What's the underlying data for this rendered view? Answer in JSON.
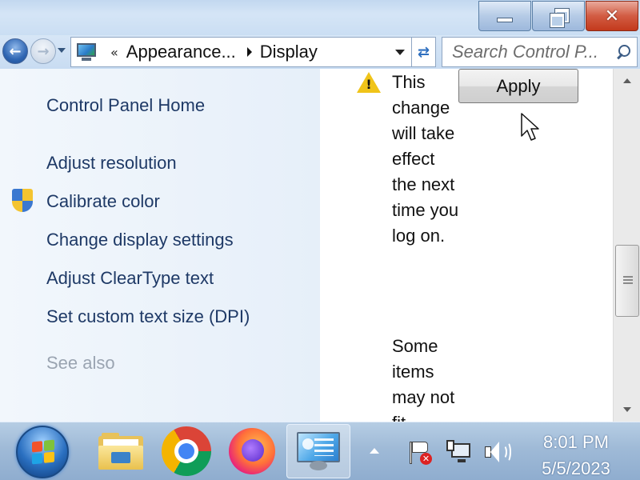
{
  "window": {
    "min_glyph": "—",
    "close_glyph": "✕"
  },
  "navigation": {
    "back_glyph": "←",
    "forward_glyph": "→",
    "breadcrumb_prefix": "«",
    "breadcrumbs": [
      "Appearance...",
      "Display"
    ],
    "refresh_glyph": "⇄",
    "search_placeholder": "Search Control P..."
  },
  "sidebar": {
    "home": "Control Panel Home",
    "links": [
      "Adjust resolution",
      "Calibrate color",
      "Change display settings",
      "Adjust ClearType text",
      "Set custom text size (DPI)"
    ],
    "see_also": "See also"
  },
  "content": {
    "warning_text": "This change will take effect the next time you log on.",
    "second_text": "Some items may not fit",
    "apply_label": "Apply"
  },
  "taskbar": {
    "apps": [
      "windows-explorer",
      "google-chrome",
      "firefox",
      "display-control-panel"
    ],
    "active_app": "display-control-panel",
    "time": "8:01 PM",
    "date": "5/5/2023"
  },
  "colors": {
    "link": "#1e3966",
    "see_also": "#9aa4b1",
    "close_button": "#c3391c",
    "warning": "#f0c419"
  }
}
